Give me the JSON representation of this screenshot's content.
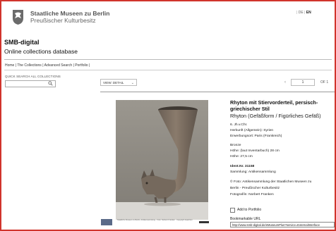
{
  "header": {
    "org_name": "Staatliche Museen zu Berlin",
    "org_sub": "Preußischer Kulturbesitz",
    "lang": {
      "de": "DE",
      "en": "EN"
    }
  },
  "site": {
    "title": "SMB-digital",
    "subtitle": "Online collections database"
  },
  "nav": {
    "home": "Home",
    "collections": "The Collections",
    "advanced": "Advanced Search",
    "portfolio": "Portfolio"
  },
  "quick_search": {
    "label": "QUICK SEARCH ALL COLLECTIONS",
    "value": ""
  },
  "view": {
    "label": "VIEW: DETAIL",
    "chev": "⌄"
  },
  "pager": {
    "current": "1",
    "of": "OF 1",
    "prev": "‹"
  },
  "image_credit": "Staatliche Museen zu Berlin, Antikensammlung · Foto: Norbert Franken · Copyright beachten",
  "object": {
    "title": "Rhyton mit Stiervorderteil, persisch-griechischer Stil",
    "type": "Rhyton (Gefäßform / Figürliches Gefäß)",
    "date": "6. Jh.v.Chr.",
    "origin": "Herkunft (Allgemein): Syrien",
    "acquisition": "Erwerbungsort: Paris (Frankreich)",
    "material": "Bronze",
    "height_inv": "Höhe: (laut Inventarbuch) 28 cm",
    "height": "Höhe: 27,5 cm",
    "ident": "Ident.Nr. 31158",
    "collection": "Sammlung: Antikensammlung",
    "photo_credit_1": "© Foto: Antikensammlung der Staatlichen Museen zu",
    "photo_credit_2": "Berlin - Preußischer Kulturbesitz",
    "photographer": "Fotograf/in: Norbert Franken",
    "add_portfolio": "Add to Portfolio",
    "bookmark_label": "Bookmarkable URL",
    "bookmark_url": "http://www.smb-digital.de/eMuseumPlus?service=ExternalInterface"
  },
  "colors": {
    "frame": "#d0342c",
    "photo_bg": "#8e8a83",
    "bronze": "#7a6a5a"
  },
  "icons": {
    "logo": "eagle-logo-icon",
    "search": "search-icon"
  }
}
